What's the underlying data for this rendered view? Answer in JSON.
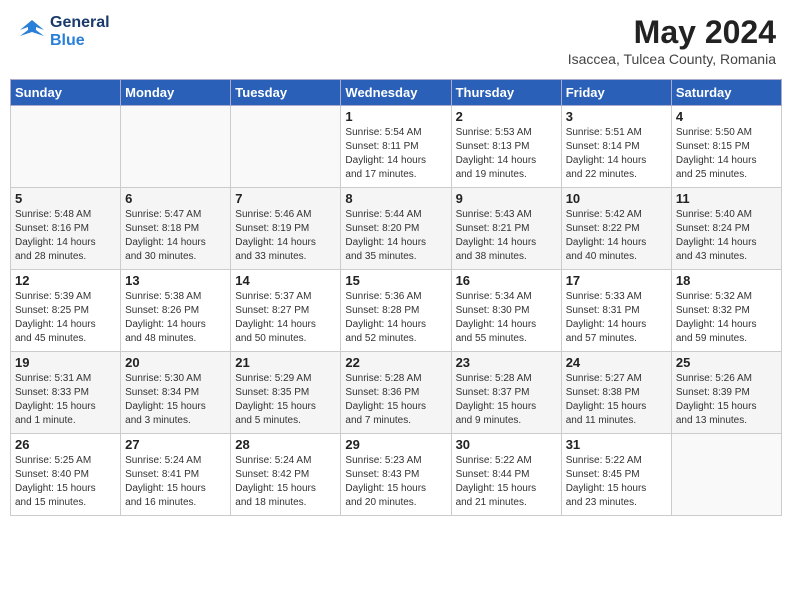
{
  "header": {
    "logo_line1": "General",
    "logo_line2": "Blue",
    "month_year": "May 2024",
    "location": "Isaccea, Tulcea County, Romania"
  },
  "days_of_week": [
    "Sunday",
    "Monday",
    "Tuesday",
    "Wednesday",
    "Thursday",
    "Friday",
    "Saturday"
  ],
  "weeks": [
    [
      {
        "num": "",
        "info": ""
      },
      {
        "num": "",
        "info": ""
      },
      {
        "num": "",
        "info": ""
      },
      {
        "num": "1",
        "info": "Sunrise: 5:54 AM\nSunset: 8:11 PM\nDaylight: 14 hours\nand 17 minutes."
      },
      {
        "num": "2",
        "info": "Sunrise: 5:53 AM\nSunset: 8:13 PM\nDaylight: 14 hours\nand 19 minutes."
      },
      {
        "num": "3",
        "info": "Sunrise: 5:51 AM\nSunset: 8:14 PM\nDaylight: 14 hours\nand 22 minutes."
      },
      {
        "num": "4",
        "info": "Sunrise: 5:50 AM\nSunset: 8:15 PM\nDaylight: 14 hours\nand 25 minutes."
      }
    ],
    [
      {
        "num": "5",
        "info": "Sunrise: 5:48 AM\nSunset: 8:16 PM\nDaylight: 14 hours\nand 28 minutes."
      },
      {
        "num": "6",
        "info": "Sunrise: 5:47 AM\nSunset: 8:18 PM\nDaylight: 14 hours\nand 30 minutes."
      },
      {
        "num": "7",
        "info": "Sunrise: 5:46 AM\nSunset: 8:19 PM\nDaylight: 14 hours\nand 33 minutes."
      },
      {
        "num": "8",
        "info": "Sunrise: 5:44 AM\nSunset: 8:20 PM\nDaylight: 14 hours\nand 35 minutes."
      },
      {
        "num": "9",
        "info": "Sunrise: 5:43 AM\nSunset: 8:21 PM\nDaylight: 14 hours\nand 38 minutes."
      },
      {
        "num": "10",
        "info": "Sunrise: 5:42 AM\nSunset: 8:22 PM\nDaylight: 14 hours\nand 40 minutes."
      },
      {
        "num": "11",
        "info": "Sunrise: 5:40 AM\nSunset: 8:24 PM\nDaylight: 14 hours\nand 43 minutes."
      }
    ],
    [
      {
        "num": "12",
        "info": "Sunrise: 5:39 AM\nSunset: 8:25 PM\nDaylight: 14 hours\nand 45 minutes."
      },
      {
        "num": "13",
        "info": "Sunrise: 5:38 AM\nSunset: 8:26 PM\nDaylight: 14 hours\nand 48 minutes."
      },
      {
        "num": "14",
        "info": "Sunrise: 5:37 AM\nSunset: 8:27 PM\nDaylight: 14 hours\nand 50 minutes."
      },
      {
        "num": "15",
        "info": "Sunrise: 5:36 AM\nSunset: 8:28 PM\nDaylight: 14 hours\nand 52 minutes."
      },
      {
        "num": "16",
        "info": "Sunrise: 5:34 AM\nSunset: 8:30 PM\nDaylight: 14 hours\nand 55 minutes."
      },
      {
        "num": "17",
        "info": "Sunrise: 5:33 AM\nSunset: 8:31 PM\nDaylight: 14 hours\nand 57 minutes."
      },
      {
        "num": "18",
        "info": "Sunrise: 5:32 AM\nSunset: 8:32 PM\nDaylight: 14 hours\nand 59 minutes."
      }
    ],
    [
      {
        "num": "19",
        "info": "Sunrise: 5:31 AM\nSunset: 8:33 PM\nDaylight: 15 hours\nand 1 minute."
      },
      {
        "num": "20",
        "info": "Sunrise: 5:30 AM\nSunset: 8:34 PM\nDaylight: 15 hours\nand 3 minutes."
      },
      {
        "num": "21",
        "info": "Sunrise: 5:29 AM\nSunset: 8:35 PM\nDaylight: 15 hours\nand 5 minutes."
      },
      {
        "num": "22",
        "info": "Sunrise: 5:28 AM\nSunset: 8:36 PM\nDaylight: 15 hours\nand 7 minutes."
      },
      {
        "num": "23",
        "info": "Sunrise: 5:28 AM\nSunset: 8:37 PM\nDaylight: 15 hours\nand 9 minutes."
      },
      {
        "num": "24",
        "info": "Sunrise: 5:27 AM\nSunset: 8:38 PM\nDaylight: 15 hours\nand 11 minutes."
      },
      {
        "num": "25",
        "info": "Sunrise: 5:26 AM\nSunset: 8:39 PM\nDaylight: 15 hours\nand 13 minutes."
      }
    ],
    [
      {
        "num": "26",
        "info": "Sunrise: 5:25 AM\nSunset: 8:40 PM\nDaylight: 15 hours\nand 15 minutes."
      },
      {
        "num": "27",
        "info": "Sunrise: 5:24 AM\nSunset: 8:41 PM\nDaylight: 15 hours\nand 16 minutes."
      },
      {
        "num": "28",
        "info": "Sunrise: 5:24 AM\nSunset: 8:42 PM\nDaylight: 15 hours\nand 18 minutes."
      },
      {
        "num": "29",
        "info": "Sunrise: 5:23 AM\nSunset: 8:43 PM\nDaylight: 15 hours\nand 20 minutes."
      },
      {
        "num": "30",
        "info": "Sunrise: 5:22 AM\nSunset: 8:44 PM\nDaylight: 15 hours\nand 21 minutes."
      },
      {
        "num": "31",
        "info": "Sunrise: 5:22 AM\nSunset: 8:45 PM\nDaylight: 15 hours\nand 23 minutes."
      },
      {
        "num": "",
        "info": ""
      }
    ]
  ]
}
